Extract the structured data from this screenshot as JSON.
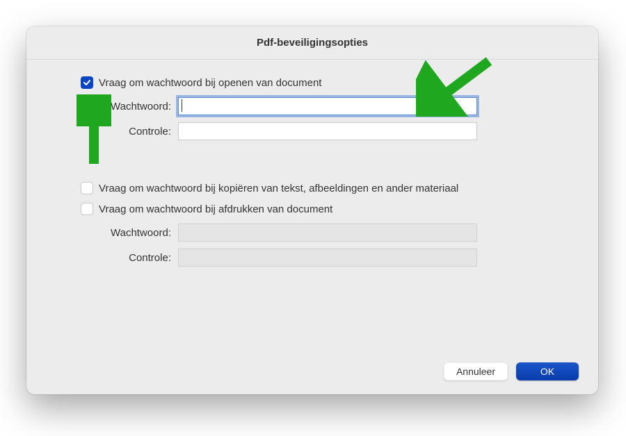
{
  "dialog": {
    "title": "Pdf-beveiligingsopties"
  },
  "section_open": {
    "checkbox_label": "Vraag om wachtwoord bij openen van document",
    "checked": true,
    "password_label": "Wachtwoord:",
    "password_value": "",
    "verify_label": "Controle:",
    "verify_value": ""
  },
  "section_other": {
    "checkbox_copy_label": "Vraag om wachtwoord bij kopiëren van tekst, afbeeldingen en ander materiaal",
    "checkbox_copy_checked": false,
    "checkbox_print_label": "Vraag om wachtwoord bij afdrukken van document",
    "checkbox_print_checked": false,
    "password_label": "Wachtwoord:",
    "verify_label": "Controle:"
  },
  "buttons": {
    "cancel": "Annuleer",
    "ok": "OK"
  },
  "annotations": {
    "arrow_to_checkbox": "green-arrow",
    "arrow_to_password": "green-arrow",
    "color": "#1fa81f"
  }
}
